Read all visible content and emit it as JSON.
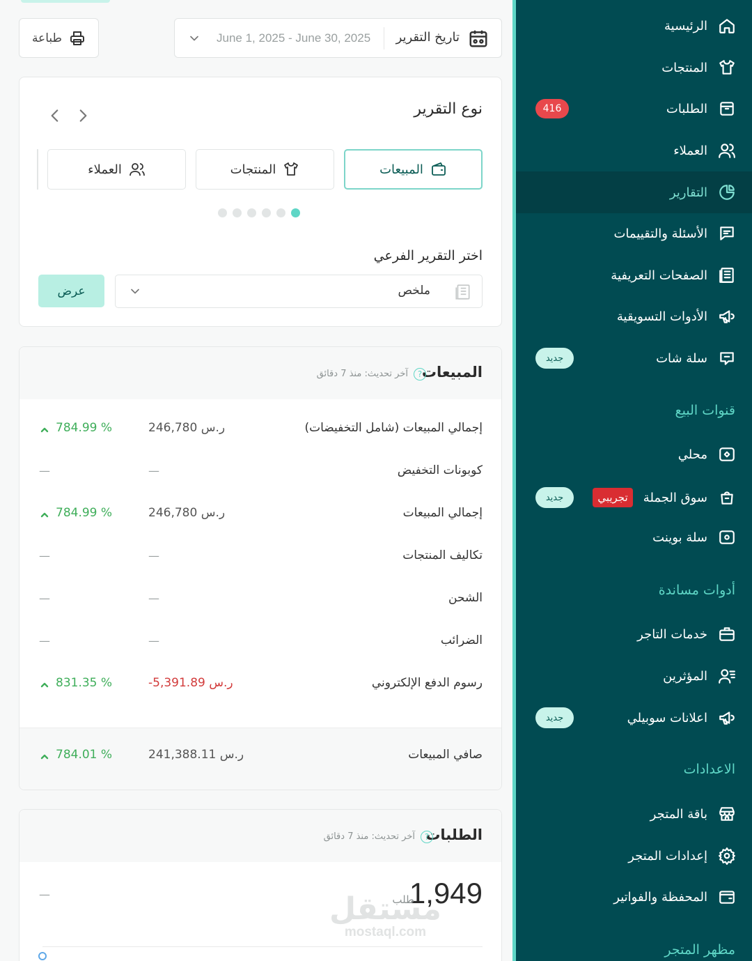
{
  "sidebar": {
    "items": [
      {
        "label": "الرئيسية",
        "icon": "home-icon"
      },
      {
        "label": "المنتجات",
        "icon": "shirt-icon"
      },
      {
        "label": "الطلبات",
        "icon": "box-icon",
        "badge": "416"
      },
      {
        "label": "العملاء",
        "icon": "users-icon"
      },
      {
        "label": "التقارير",
        "icon": "pie-chart-icon",
        "active": true
      },
      {
        "label": "الأسئلة والتقييمات",
        "icon": "chat-icon"
      },
      {
        "label": "الصفحات التعريفية",
        "icon": "pages-icon"
      },
      {
        "label": "الأدوات التسويقية",
        "icon": "megaphone-icon"
      },
      {
        "label": "سلة شات",
        "icon": "chat-bubble-icon",
        "new_badge": "جديد"
      }
    ],
    "sales_channels_title": "قنوات البيع",
    "sales_channels": [
      {
        "label": "محلي",
        "icon": "tag-icon"
      },
      {
        "label": "سوق الجملة",
        "icon": "bag-icon",
        "trial_badge": "تجريبي",
        "new_badge": "جديد"
      },
      {
        "label": "سلة بوينت",
        "icon": "point-icon"
      }
    ],
    "tools_title": "أدوات مساندة",
    "tools": [
      {
        "label": "خدمات التاجر",
        "icon": "briefcase-icon"
      },
      {
        "label": "المؤثرين",
        "icon": "influencer-icon"
      },
      {
        "label": "اعلانات سوبيلي",
        "icon": "megaphone-icon",
        "new_badge": "جديد"
      }
    ],
    "settings_title": "الاعدادات",
    "settings": [
      {
        "label": "باقة المتجر",
        "icon": "store-icon"
      },
      {
        "label": "إعدادات المتجر",
        "icon": "gear-icon"
      },
      {
        "label": "المحفظة والفواتير",
        "icon": "wallet-icon"
      }
    ],
    "appearance_title": "مظهر المتجر"
  },
  "toolbar": {
    "print_label": "طباعة",
    "date_label": "تاريخ التقرير",
    "date_value": "June 1, 2025 - June 30, 2025"
  },
  "report_type": {
    "title": "نوع التقرير",
    "tabs": [
      {
        "label": "المبيعات",
        "icon": "wallet-icon",
        "active": true
      },
      {
        "label": "المنتجات",
        "icon": "shirt-icon"
      },
      {
        "label": "العملاء",
        "icon": "users-icon"
      }
    ],
    "sub_title": "اختر التقرير الفرعي",
    "sub_value": "ملخص",
    "show_label": "عرض"
  },
  "sales": {
    "title": "المبيعات",
    "updated": "آخر تحديث: منذ 7 دقائق",
    "rows": [
      {
        "label": "إجمالي المبيعات (شامل التخفيضات)",
        "value": "246,780 ر.س",
        "pct": "784.99 %"
      },
      {
        "label": "كوبونات التخفيض",
        "value": "—",
        "pct": "—"
      },
      {
        "label": "إجمالي المبيعات",
        "value": "246,780 ر.س",
        "pct": "784.99 %"
      },
      {
        "label": "تكاليف المنتجات",
        "value": "—",
        "pct": "—"
      },
      {
        "label": "الشحن",
        "value": "—",
        "pct": "—"
      },
      {
        "label": "الضرائب",
        "value": "—",
        "pct": "—"
      },
      {
        "label": "رسوم الدفع الإلكتروني",
        "value": "-5,391.89 ر.س",
        "pct": "831.35 %"
      }
    ],
    "net_label": "صافي المبيعات",
    "net_value": "241,388.11 ر.س",
    "net_pct": "784.01 %"
  },
  "orders": {
    "title": "الطلبات",
    "updated": "آخر تحديث: منذ 7 دقائق",
    "count": "1,949",
    "unit": "طلب",
    "change": "—"
  },
  "watermark": {
    "ar": "مستقل",
    "en": "mostaql.com"
  },
  "colors": {
    "sidebar": "#014b52",
    "accent": "#5fd6c6",
    "positive": "#3fae5a",
    "negative": "#d23b3b"
  }
}
